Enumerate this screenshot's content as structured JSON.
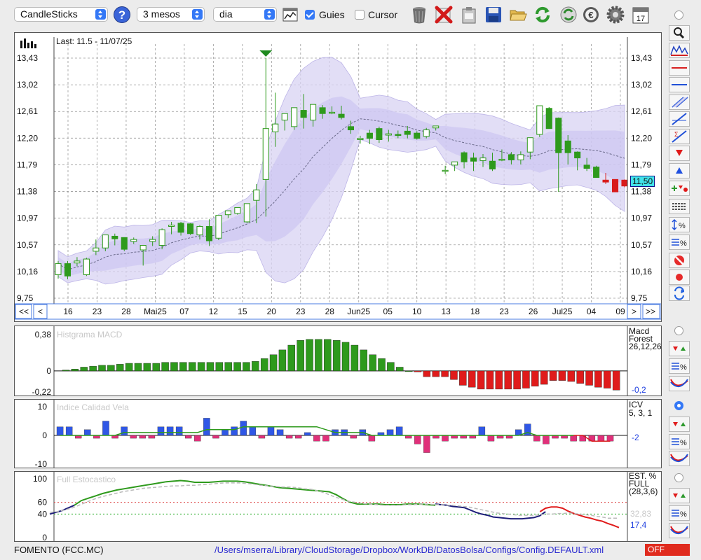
{
  "toolbar": {
    "chart_type": "CandleSticks",
    "period": "3 mesos",
    "interval": "dia",
    "guides_label": "Guies",
    "guides_checked": true,
    "cursor_label": "Cursor",
    "cursor_checked": false,
    "help_label": "?",
    "calendar_day": "17",
    "icons": [
      "chart-settings-icon",
      "trash-icon",
      "delete-icon",
      "clipboard-icon",
      "save-icon",
      "open-folder-icon",
      "refresh-icon",
      "sync-icon",
      "currency-icon",
      "gear-icon",
      "calendar-icon"
    ]
  },
  "main": {
    "last_label": "Last: 11.5 - 11/07/25",
    "price_badge": "11,50",
    "y_ticks": [
      "13,43",
      "13,02",
      "12,61",
      "12,20",
      "11,79",
      "11,38",
      "10,97",
      "10,57",
      "10,16",
      "9,75"
    ],
    "x_labels": [
      "16",
      "23",
      "28",
      "Mai25",
      "07",
      "12",
      "15",
      "20",
      "23",
      "28",
      "Jun25",
      "05",
      "10",
      "13",
      "18",
      "23",
      "26",
      "Jul25",
      "04",
      "09"
    ],
    "nav_prev_fast": "<<",
    "nav_prev": "<",
    "nav_next": ">",
    "nav_next_fast": ">>"
  },
  "macd": {
    "title": "Histgrama MACD",
    "y_ticks": [
      "0,38",
      "0",
      "-0,22"
    ],
    "name_line1": "Macd",
    "name_line2": "Forest",
    "params": "26,12,26",
    "value": "-0,2",
    "colors": {
      "positive": "#2e9a1c",
      "negative": "#e01b1b"
    }
  },
  "icv": {
    "title": "Indice Calidad Vela",
    "y_ticks": [
      "10",
      "0",
      "-10"
    ],
    "name": "ICV",
    "params": "5, 3, 1",
    "value": "-2",
    "colors": {
      "positive": "#2f57e6",
      "negative": "#e0307a",
      "line": "#2e9a1c"
    }
  },
  "stoch": {
    "title": "Full Estocastico",
    "y_ticks": [
      "100",
      "60",
      "40",
      "0"
    ],
    "name_line1": "EST. %",
    "name_line2": "FULL",
    "params": "(28,3,6)",
    "value_d": "32,83",
    "value_k": "17,4"
  },
  "footer": {
    "ticker": "FOMENTO (FCC.MC)",
    "path": "/Users/mserra/Library/CloudStorage/Dropbox/WorkDB/DatosBolsa/Configs/Config.DEFAULT.xml",
    "status": "OFF"
  },
  "chart_data": [
    {
      "type": "candlestick",
      "ylim": [
        9.75,
        13.43
      ],
      "x_labels": [
        "16",
        "23",
        "28",
        "Mai25",
        "07",
        "12",
        "15",
        "20",
        "23",
        "28",
        "Jun25",
        "05",
        "10",
        "13",
        "18",
        "23",
        "26",
        "Jul25",
        "04",
        "09"
      ],
      "candles": [
        {
          "o": 10.11,
          "h": 10.32,
          "l": 10.05,
          "c": 10.28
        },
        {
          "o": 10.28,
          "h": 10.32,
          "l": 10.04,
          "c": 10.09
        },
        {
          "o": 10.29,
          "h": 10.38,
          "l": 10.24,
          "c": 10.32
        },
        {
          "o": 10.11,
          "h": 10.37,
          "l": 10.09,
          "c": 10.35
        },
        {
          "o": 10.47,
          "h": 10.65,
          "l": 10.41,
          "c": 10.52
        },
        {
          "o": 10.52,
          "h": 10.72,
          "l": 10.47,
          "c": 10.72
        },
        {
          "o": 10.7,
          "h": 10.74,
          "l": 10.56,
          "c": 10.66
        },
        {
          "o": 10.68,
          "h": 10.68,
          "l": 10.47,
          "c": 10.5
        },
        {
          "o": 10.62,
          "h": 10.68,
          "l": 10.58,
          "c": 10.65
        },
        {
          "o": 10.49,
          "h": 10.55,
          "l": 10.25,
          "c": 10.56
        },
        {
          "o": 10.62,
          "h": 10.7,
          "l": 10.55,
          "c": 10.65
        },
        {
          "o": 10.56,
          "h": 10.82,
          "l": 10.5,
          "c": 10.8
        },
        {
          "o": 10.85,
          "h": 10.92,
          "l": 10.73,
          "c": 10.87
        },
        {
          "o": 10.9,
          "h": 10.92,
          "l": 10.71,
          "c": 10.76
        },
        {
          "o": 10.89,
          "h": 10.9,
          "l": 10.72,
          "c": 10.74
        },
        {
          "o": 10.72,
          "h": 10.87,
          "l": 10.65,
          "c": 10.85
        },
        {
          "o": 10.85,
          "h": 10.96,
          "l": 10.55,
          "c": 10.63
        },
        {
          "o": 10.67,
          "h": 11.02,
          "l": 10.64,
          "c": 11.02
        },
        {
          "o": 11.03,
          "h": 11.09,
          "l": 10.98,
          "c": 11.09
        },
        {
          "o": 11.05,
          "h": 11.14,
          "l": 11.03,
          "c": 11.14
        },
        {
          "o": 10.92,
          "h": 11.2,
          "l": 10.9,
          "c": 11.2
        },
        {
          "o": 11.25,
          "h": 11.5,
          "l": 10.9,
          "c": 11.41
        },
        {
          "o": 11.57,
          "h": 13.43,
          "l": 11.0,
          "c": 12.35
        },
        {
          "o": 12.3,
          "h": 12.9,
          "l": 12.07,
          "c": 12.42
        },
        {
          "o": 12.48,
          "h": 12.58,
          "l": 12.32,
          "c": 12.58
        },
        {
          "o": 12.38,
          "h": 12.59,
          "l": 12.33,
          "c": 12.67
        },
        {
          "o": 12.63,
          "h": 12.88,
          "l": 12.35,
          "c": 12.52
        },
        {
          "o": 12.48,
          "h": 12.72,
          "l": 12.38,
          "c": 12.72
        },
        {
          "o": 12.67,
          "h": 12.71,
          "l": 12.5,
          "c": 12.58
        },
        {
          "o": 12.6,
          "h": 12.69,
          "l": 12.57,
          "c": 12.6
        },
        {
          "o": 12.57,
          "h": 12.7,
          "l": 12.49,
          "c": 12.52
        },
        {
          "o": 12.38,
          "h": 12.47,
          "l": 12.27,
          "c": 12.33
        },
        {
          "o": 12.18,
          "h": 12.24,
          "l": 12.12,
          "c": 12.2
        },
        {
          "o": 12.28,
          "h": 12.33,
          "l": 12.11,
          "c": 12.2
        },
        {
          "o": 12.35,
          "h": 12.38,
          "l": 12.13,
          "c": 12.18
        },
        {
          "o": 12.25,
          "h": 12.33,
          "l": 12.15,
          "c": 12.27
        },
        {
          "o": 12.26,
          "h": 12.32,
          "l": 12.2,
          "c": 12.25
        },
        {
          "o": 12.31,
          "h": 12.39,
          "l": 12.2,
          "c": 12.26
        },
        {
          "o": 12.28,
          "h": 12.31,
          "l": 12.18,
          "c": 12.2
        },
        {
          "o": 12.23,
          "h": 12.36,
          "l": 12.2,
          "c": 12.33
        },
        {
          "o": 12.36,
          "h": 12.39,
          "l": 12.32,
          "c": 12.39
        },
        {
          "o": 11.71,
          "h": 11.78,
          "l": 11.65,
          "c": 11.71
        },
        {
          "o": 11.79,
          "h": 11.84,
          "l": 11.7,
          "c": 11.84
        },
        {
          "o": 11.98,
          "h": 12.0,
          "l": 11.74,
          "c": 11.84
        },
        {
          "o": 11.9,
          "h": 11.98,
          "l": 11.7,
          "c": 11.85
        },
        {
          "o": 11.86,
          "h": 11.96,
          "l": 11.76,
          "c": 11.9
        },
        {
          "o": 11.85,
          "h": 11.98,
          "l": 11.7,
          "c": 11.73
        },
        {
          "o": 11.88,
          "h": 12.03,
          "l": 11.85,
          "c": 11.88
        },
        {
          "o": 11.95,
          "h": 11.99,
          "l": 11.8,
          "c": 11.87
        },
        {
          "o": 11.87,
          "h": 12.0,
          "l": 11.8,
          "c": 11.95
        },
        {
          "o": 11.99,
          "h": 12.2,
          "l": 11.88,
          "c": 12.21
        },
        {
          "o": 12.26,
          "h": 12.68,
          "l": 12.22,
          "c": 12.7
        },
        {
          "o": 12.66,
          "h": 12.68,
          "l": 12.35,
          "c": 12.35
        },
        {
          "o": 12.51,
          "h": 12.52,
          "l": 11.38,
          "c": 11.98
        },
        {
          "o": 12.16,
          "h": 12.25,
          "l": 11.8,
          "c": 11.98
        },
        {
          "o": 11.99,
          "h": 12.0,
          "l": 11.71,
          "c": 11.9
        },
        {
          "o": 11.79,
          "h": 11.9,
          "l": 11.7,
          "c": 11.74
        },
        {
          "o": 11.76,
          "h": 11.78,
          "l": 11.6,
          "c": 11.6
        },
        {
          "o": 11.56,
          "h": 11.67,
          "l": 11.5,
          "c": 11.53
        },
        {
          "o": 11.57,
          "h": 11.57,
          "l": 11.38,
          "c": 11.38
        },
        {
          "o": 11.56,
          "h": 11.57,
          "l": 11.45,
          "c": 11.47
        }
      ],
      "annotation": "▼ at peak (13,43)",
      "last_value": 11.5
    },
    {
      "type": "bar",
      "title": "Histgrama MACD",
      "ylim": [
        -0.22,
        0.38
      ],
      "values": [
        0.01,
        0.02,
        0.04,
        0.05,
        0.06,
        0.06,
        0.07,
        0.08,
        0.08,
        0.08,
        0.08,
        0.09,
        0.09,
        0.09,
        0.09,
        0.09,
        0.09,
        0.09,
        0.09,
        0.09,
        0.09,
        0.1,
        0.13,
        0.17,
        0.22,
        0.27,
        0.32,
        0.33,
        0.33,
        0.33,
        0.32,
        0.3,
        0.27,
        0.22,
        0.17,
        0.13,
        0.09,
        0.04,
        0.0,
        -0.01,
        -0.06,
        -0.06,
        -0.06,
        -0.09,
        -0.15,
        -0.17,
        -0.19,
        -0.19,
        -0.19,
        -0.19,
        -0.19,
        -0.18,
        -0.16,
        -0.14,
        -0.1,
        -0.1,
        -0.11,
        -0.13,
        -0.15,
        -0.17,
        -0.18,
        -0.2
      ]
    },
    {
      "type": "bar",
      "title": "Indice Calidad Vela",
      "ylim": [
        -10,
        10
      ],
      "values": [
        3,
        3,
        -1,
        2,
        -1,
        5,
        -1,
        3,
        -1,
        -1,
        -1,
        3,
        3,
        3,
        -1,
        -2,
        6,
        -1,
        2,
        3,
        5,
        3,
        -1,
        3,
        2,
        -1,
        -1,
        1,
        -2,
        -2,
        2,
        2,
        -1,
        2,
        -2,
        1,
        2,
        3,
        -1,
        -3,
        -6,
        -1,
        -2,
        -1,
        -1,
        -1,
        3,
        -2,
        -1,
        -1,
        2,
        4,
        -2,
        -3,
        -1,
        -1,
        -2,
        -2,
        -2,
        -2,
        -2
      ],
      "signal_line": [
        0,
        0,
        0,
        0,
        0,
        0,
        0,
        1,
        1,
        1,
        1,
        1,
        1,
        1,
        1,
        1,
        2,
        2,
        2,
        2,
        3,
        3,
        3,
        3,
        3,
        3,
        3,
        3,
        3,
        2,
        1,
        1,
        1,
        1,
        0,
        0,
        0,
        0,
        0,
        0,
        0,
        0,
        0,
        0,
        0,
        0,
        0,
        0,
        0,
        0,
        0,
        1,
        0,
        0,
        0,
        0,
        0,
        0,
        -2,
        -2,
        -2
      ]
    },
    {
      "type": "line",
      "title": "Full Estocastico",
      "ylim": [
        0,
        100
      ],
      "series": [
        {
          "values": [
            40,
            45,
            55,
            63,
            67,
            71,
            75,
            78,
            81,
            83,
            85,
            87,
            89,
            91,
            93,
            95,
            96,
            97,
            96,
            94,
            94,
            94,
            95,
            96,
            96,
            96,
            95,
            93,
            91,
            89,
            87,
            85,
            84,
            83,
            82,
            81,
            80,
            79,
            78,
            73,
            66,
            60,
            57,
            57,
            57,
            57,
            56,
            56,
            56,
            57,
            57,
            57,
            56,
            55
          ]
        },
        {
          "values": [
            43,
            44,
            47,
            50,
            55,
            60,
            65,
            69,
            72,
            75,
            78,
            80,
            82,
            84,
            85,
            86,
            87,
            88,
            88,
            89,
            89,
            90,
            91,
            92,
            93,
            93,
            93,
            92,
            91,
            89,
            88,
            87,
            86,
            86,
            85,
            83,
            82,
            79,
            75,
            70,
            66,
            62,
            60,
            58,
            57,
            56,
            55,
            55,
            55,
            56,
            56,
            57,
            57,
            56
          ]
        },
        {
          "values": [
            57,
            56,
            55,
            53,
            52,
            51,
            47,
            43,
            40,
            38,
            35,
            34,
            33,
            32,
            32,
            32,
            33,
            34,
            37,
            44,
            50,
            52,
            52,
            50,
            45,
            41,
            38,
            35,
            33,
            30,
            28,
            24,
            21,
            17
          ]
        },
        {
          "values": [
            56,
            56,
            55,
            55,
            54,
            53,
            52,
            50,
            48,
            46,
            44,
            42,
            41,
            40,
            39,
            38,
            38,
            38,
            38,
            39,
            40,
            40,
            41,
            41,
            42,
            41,
            40,
            39,
            38,
            36,
            35,
            33,
            33,
            33
          ]
        }
      ],
      "reference_lines": [
        60,
        40
      ]
    }
  ]
}
